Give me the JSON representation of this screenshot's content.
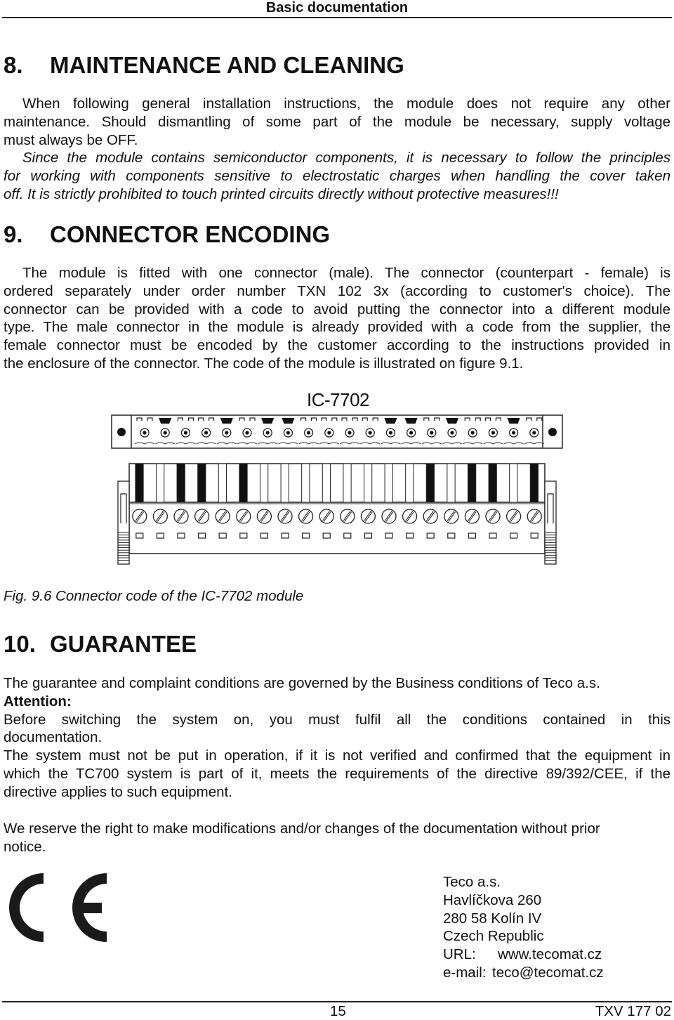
{
  "header": {
    "title": "Basic documentation"
  },
  "sections": {
    "maintenance": {
      "number": "8.",
      "title": "MAINTENANCE AND CLEANING",
      "para1_lines": [
        "When following general installation instructions, the module does not require any other",
        "maintenance. Should dismantling of some part of the module be necessary, supply voltage",
        "must always be OFF."
      ],
      "para2_lines": [
        "Since the module contains semiconductor components, it is necessary to follow the principles",
        "for working with components sensitive to electrostatic charges when handling the cover taken",
        "off. It is strictly prohibited to touch printed circuits directly without protective measures!!!"
      ]
    },
    "connector": {
      "number": "9.",
      "title": "CONNECTOR ENCODING",
      "para_lines": [
        "The module is fitted with one connector (male). The connector (counterpart - female) is",
        "ordered separately under order number TXN 102 3x (according to customer's choice). The",
        "connector can be provided with a code to avoid putting the connector into a different module",
        "type. The male connector in the module is already provided with a code from the supplier, the",
        "female connector must be encoded by the customer according to the instructions provided in",
        "the enclosure of the connector. The code of the module is illustrated on figure 9.1."
      ],
      "figure": {
        "title": "IC-7702",
        "pin_count": 20,
        "male_coded_pins": [
          2,
          5,
          7,
          8,
          13,
          14,
          16,
          19
        ],
        "female_coded_slots": [
          1,
          3,
          4,
          6,
          15,
          17,
          18,
          20
        ],
        "caption": "Fig. 9.6 Connector code of the IC-7702 module"
      }
    },
    "guarantee": {
      "number": "10.",
      "title": "GUARANTEE",
      "para1": "The guarantee and complaint conditions are governed by the Business conditions of Teco a.s.",
      "attention_label": "Attention:",
      "para2_lines": [
        "Before switching the system on, you must fulfil all the conditions contained in this",
        "documentation."
      ],
      "para3_lines": [
        "The system must not be put in operation, if it is not verified and confirmed that the equipment in",
        "which the TC700 system is part of it, meets the requirements of the directive 89/392/CEE, if the",
        "directive applies to such equipment."
      ],
      "para4_lines": [
        "We reserve the right to make modifications and/or changes of the documentation without prior",
        "notice."
      ]
    }
  },
  "ce_mark": {
    "icon": "ce-mark-icon",
    "label": "CE"
  },
  "address": {
    "company": "Teco a.s.",
    "street": "Havlíčkova 260",
    "city": "280 58 Kolín IV",
    "country": "Czech Republic",
    "url_label": "URL:",
    "url": "www.tecomat.cz",
    "email_label": "e-mail:",
    "email": "teco@tecomat.cz"
  },
  "footer": {
    "page_number": "15",
    "doc_code": "TXV 177 02"
  }
}
